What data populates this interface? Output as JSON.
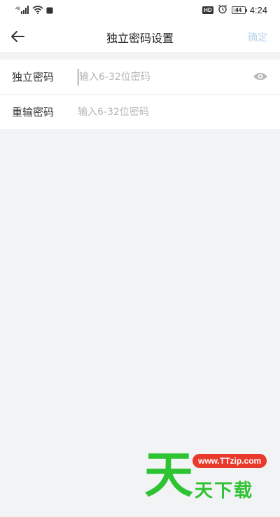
{
  "status_bar": {
    "network": "46",
    "time": "4:24",
    "battery_level": "44",
    "battery_fraction": 0.44,
    "hd_label": "HD",
    "icons": [
      "signal-icon",
      "wifi-icon",
      "notification-icon",
      "hd-icon",
      "alarm-icon",
      "battery-icon"
    ]
  },
  "nav": {
    "title": "独立密码设置",
    "confirm_label": "确定",
    "back_icon": "arrow-left-icon"
  },
  "form": {
    "rows": [
      {
        "label": "独立密码",
        "value": "",
        "placeholder": "输入6-32位密码",
        "focused": true,
        "trailing_icon": "eye-icon"
      },
      {
        "label": "重输密码",
        "value": "",
        "placeholder": "输入6-32位密码",
        "focused": false
      }
    ]
  },
  "watermark": {
    "glyph": "天",
    "url": "www.TTzip.com",
    "name": "天下载"
  },
  "colors": {
    "background": "#f2f3f5",
    "confirm_disabled": "#b8d5ef",
    "placeholder": "#b5b5b5",
    "watermark_green": "#2ec332",
    "watermark_red": "#e8392b"
  }
}
